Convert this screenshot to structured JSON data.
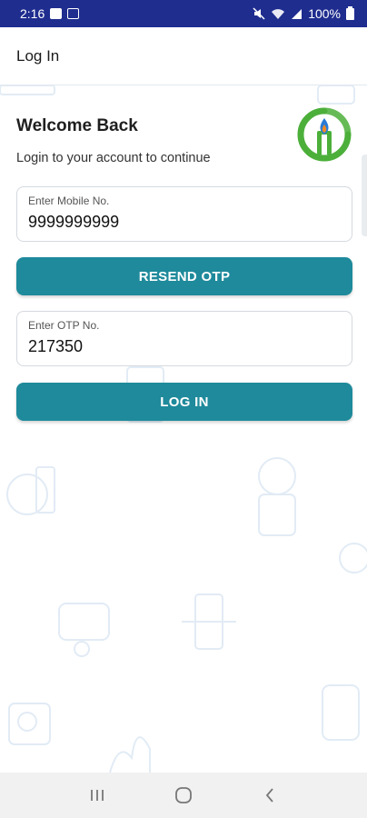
{
  "status_bar": {
    "time": "2:16",
    "battery_text": "100%",
    "icons": [
      "screen-icon",
      "gallery-icon",
      "mute-icon",
      "wifi-icon",
      "signal-icon",
      "battery-icon"
    ]
  },
  "app_bar": {
    "title": "Log In"
  },
  "login": {
    "welcome_title": "Welcome Back",
    "welcome_subtitle": "Login to your account to continue",
    "mobile_label": "Enter Mobile No.",
    "mobile_value": "9999999999",
    "resend_label": "RESEND OTP",
    "otp_label": "Enter OTP No.",
    "otp_value": "217350",
    "login_label": "LOG IN"
  },
  "colors": {
    "status_bar": "#1f2d8f",
    "button": "#1e8a9b",
    "logo_green": "#4caf3a",
    "logo_blue": "#2a7bd6",
    "logo_orange": "#f08a24"
  },
  "nav_bar": {
    "icons": [
      "recent-apps-icon",
      "home-icon",
      "back-icon"
    ]
  }
}
